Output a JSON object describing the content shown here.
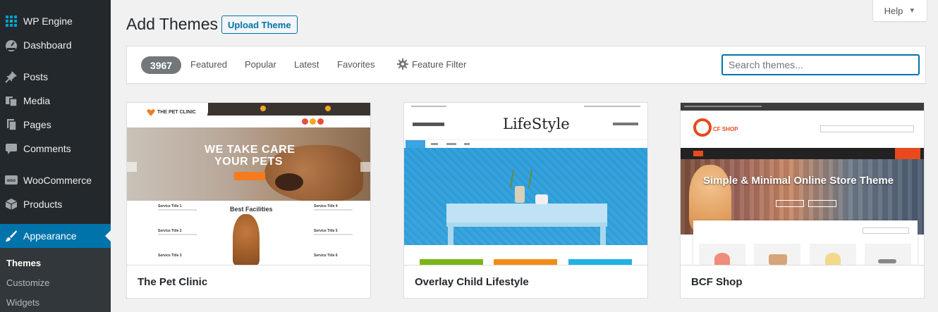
{
  "sidebar": {
    "items": [
      {
        "label": "WP Engine",
        "icon": "wp-engine-icon"
      },
      {
        "label": "Dashboard",
        "icon": "dashboard-gauge-icon"
      },
      {
        "label": "Posts",
        "icon": "pushpin-icon"
      },
      {
        "label": "Media",
        "icon": "media-icon"
      },
      {
        "label": "Pages",
        "icon": "pages-icon"
      },
      {
        "label": "Comments",
        "icon": "comment-bubble-icon"
      },
      {
        "label": "WooCommerce",
        "icon": "woocommerce-icon"
      },
      {
        "label": "Products",
        "icon": "products-box-icon"
      },
      {
        "label": "Appearance",
        "icon": "paintbrush-icon",
        "active": true
      }
    ],
    "submenu": [
      "Themes",
      "Customize",
      "Widgets"
    ],
    "current_submenu": "Themes",
    "colors": {
      "background": "#23282d",
      "active": "#0073aa",
      "submenu_bg": "#32373c"
    }
  },
  "header": {
    "title": "Add Themes",
    "upload_label": "Upload Theme",
    "help_label": "Help"
  },
  "filter": {
    "count": "3967",
    "links": [
      "Featured",
      "Popular",
      "Latest",
      "Favorites"
    ],
    "feature_filter_label": "Feature Filter",
    "search_placeholder": "Search themes..."
  },
  "themes": [
    {
      "name": "The Pet Clinic",
      "preview": {
        "logo": "THE PET CLINIC",
        "hero_line1": "WE TAKE CARE",
        "hero_line2": "YOUR PETS",
        "section_heading": "Best Facilities",
        "services": [
          "Service Title 1",
          "Service Title 2",
          "Service Title 3",
          "Service Title 4",
          "Service Title 5",
          "Service Title 6"
        ]
      }
    },
    {
      "name": "Overlay Child Lifestyle",
      "preview": {
        "logo": "LifeStyle"
      }
    },
    {
      "name": "BCF Shop",
      "preview": {
        "logo": "CF SHOP",
        "hero_text": "Simple & Minimal Online Store Theme"
      }
    }
  ]
}
